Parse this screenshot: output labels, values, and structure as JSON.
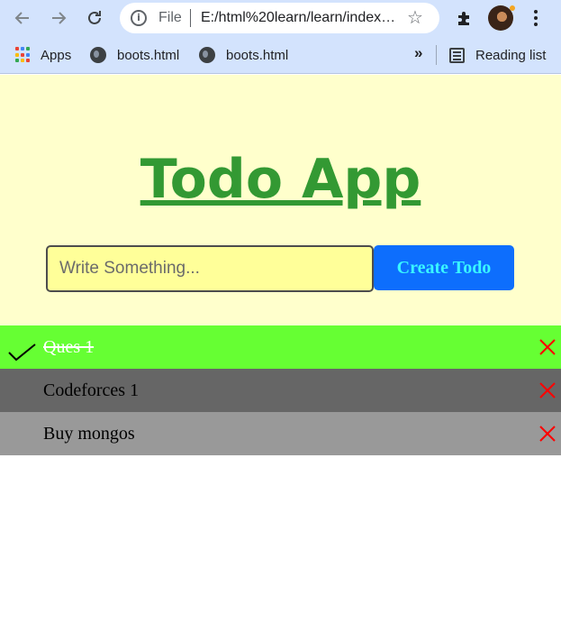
{
  "browser": {
    "omnibox": {
      "scheme_label": "File",
      "url": "E:/html%20learn/learn/index.html"
    },
    "bookmarks": [
      {
        "label": "Apps",
        "icon": "apps-grid-icon"
      },
      {
        "label": "boots.html",
        "icon": "globe-icon"
      },
      {
        "label": "boots.html",
        "icon": "globe-icon"
      }
    ],
    "overflow_label": "»",
    "reading_list_label": "Reading list"
  },
  "app": {
    "title": "Todo App",
    "input": {
      "value": "",
      "placeholder": "Write Something..."
    },
    "create_button_label": "Create Todo",
    "todos": [
      {
        "text": "Ques 1",
        "completed": true,
        "bg": "#66ff33"
      },
      {
        "text": "Codeforces 1",
        "completed": false,
        "bg": "#666666"
      },
      {
        "text": "Buy mongos",
        "completed": false,
        "bg": "#999999"
      }
    ]
  },
  "colors": {
    "hero_bg": "#ffffcc",
    "title": "#339933",
    "input_bg": "#ffff99",
    "button_bg": "#0d6efd",
    "button_text": "#39f7ff",
    "delete": "#ff0000",
    "browser_chrome": "#d3e3fd"
  }
}
